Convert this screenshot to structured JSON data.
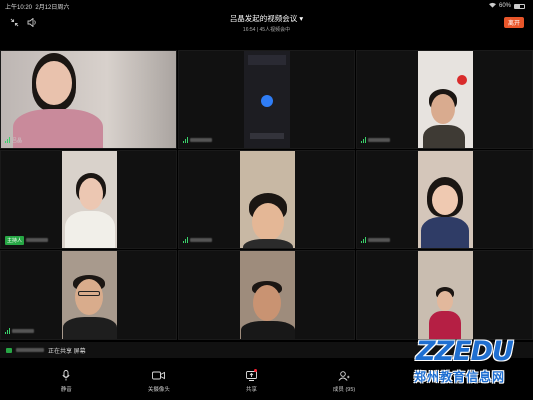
{
  "status_bar": {
    "time": "上午10:20",
    "date": "2月12日周六",
    "battery": "60%"
  },
  "header": {
    "title": "吕晶发起的视频会议",
    "subtitle": "16:54 | 45人视频会中",
    "leave_label": "离开"
  },
  "tiles": [
    {
      "name": "tile-1",
      "badge": "吕晶"
    },
    {
      "name": "tile-2",
      "badge": ""
    },
    {
      "name": "tile-3",
      "badge": ""
    },
    {
      "name": "tile-4",
      "badge": "主持人"
    },
    {
      "name": "tile-5",
      "badge": ""
    },
    {
      "name": "tile-6",
      "badge": ""
    },
    {
      "name": "tile-7",
      "badge": ""
    },
    {
      "name": "tile-8",
      "badge": ""
    },
    {
      "name": "tile-9",
      "badge": ""
    }
  ],
  "share_bar": {
    "text": "正在共享 屏幕"
  },
  "toolbar": {
    "mute_label": "静音",
    "camera_label": "关摄像头",
    "share_label": "共享",
    "members_label": "成员 (95)"
  },
  "watermark": {
    "top": "ZZEDU",
    "bottom": "郑州教育信息网"
  },
  "colors": {
    "leave_button": "#e8562a",
    "host_tag": "#27a745",
    "mic_active": "#3ad36b",
    "watermark_blue": "#1f6fd1"
  }
}
